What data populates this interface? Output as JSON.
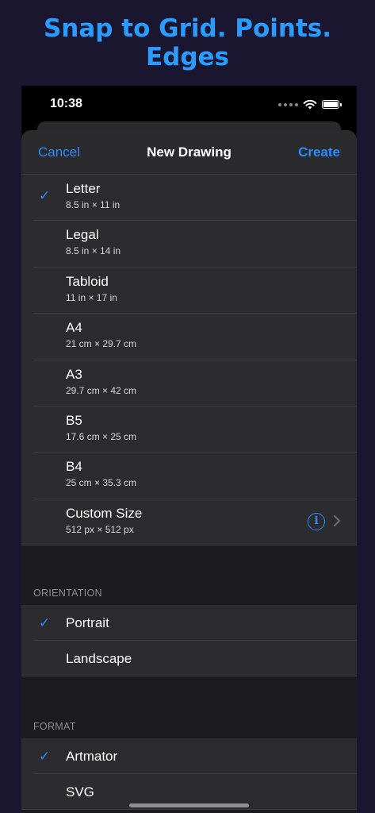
{
  "headline": "Snap to Grid. Points. Edges",
  "status": {
    "time": "10:38"
  },
  "nav": {
    "cancel": "Cancel",
    "title": "New Drawing",
    "create": "Create"
  },
  "sizes": [
    {
      "title": "Letter",
      "sub": "8.5 in × 11 in",
      "checked": true
    },
    {
      "title": "Legal",
      "sub": "8.5 in × 14 in",
      "checked": false
    },
    {
      "title": "Tabloid",
      "sub": "11 in × 17 in",
      "checked": false
    },
    {
      "title": "A4",
      "sub": "21 cm × 29.7 cm",
      "checked": false
    },
    {
      "title": "A3",
      "sub": "29.7 cm × 42 cm",
      "checked": false
    },
    {
      "title": "B5",
      "sub": "17.6 cm × 25 cm",
      "checked": false
    },
    {
      "title": "B4",
      "sub": "25 cm × 35.3 cm",
      "checked": false
    },
    {
      "title": "Custom Size",
      "sub": "512 px × 512 px",
      "checked": false
    }
  ],
  "orientation": {
    "header": "ORIENTATION",
    "items": [
      {
        "title": "Portrait",
        "checked": true
      },
      {
        "title": "Landscape",
        "checked": false
      }
    ]
  },
  "format": {
    "header": "FORMAT",
    "items": [
      {
        "title": "Artmator",
        "checked": true
      },
      {
        "title": "SVG",
        "checked": false
      }
    ]
  },
  "checkmark": "✓",
  "info_glyph": "i",
  "icons": [
    "checkmark-icon",
    "info-icon",
    "chevron-right-icon",
    "wifi-icon",
    "battery-icon",
    "signal-icon"
  ],
  "colors": {
    "accent": "#2a8cff",
    "headline": "#2a9cff",
    "background": "#1b1630"
  }
}
